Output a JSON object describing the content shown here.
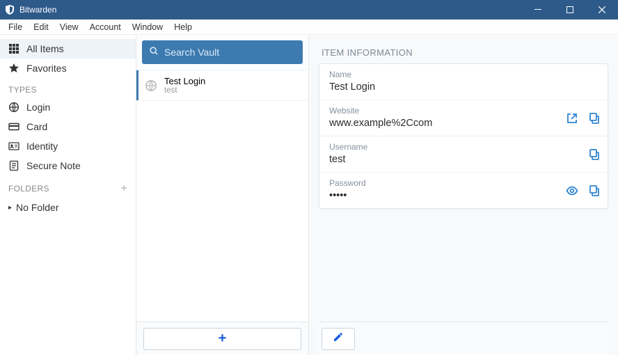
{
  "window": {
    "title": "Bitwarden"
  },
  "menu": {
    "file": "File",
    "edit": "Edit",
    "view": "View",
    "account": "Account",
    "window": "Window",
    "help": "Help"
  },
  "sidebar": {
    "all_items": "All Items",
    "favorites": "Favorites",
    "types_head": "TYPES",
    "login": "Login",
    "card": "Card",
    "identity": "Identity",
    "secure_note": "Secure Note",
    "folders_head": "FOLDERS",
    "no_folder": "No Folder"
  },
  "search": {
    "placeholder": "Search Vault"
  },
  "items": [
    {
      "title": "Test Login",
      "subtitle": "test"
    }
  ],
  "detail": {
    "section": "ITEM INFORMATION",
    "name_label": "Name",
    "name_value": "Test Login",
    "website_label": "Website",
    "website_value": "www.example%2Ccom",
    "username_label": "Username",
    "username_value": "test",
    "password_label": "Password",
    "password_value": "•••••"
  }
}
